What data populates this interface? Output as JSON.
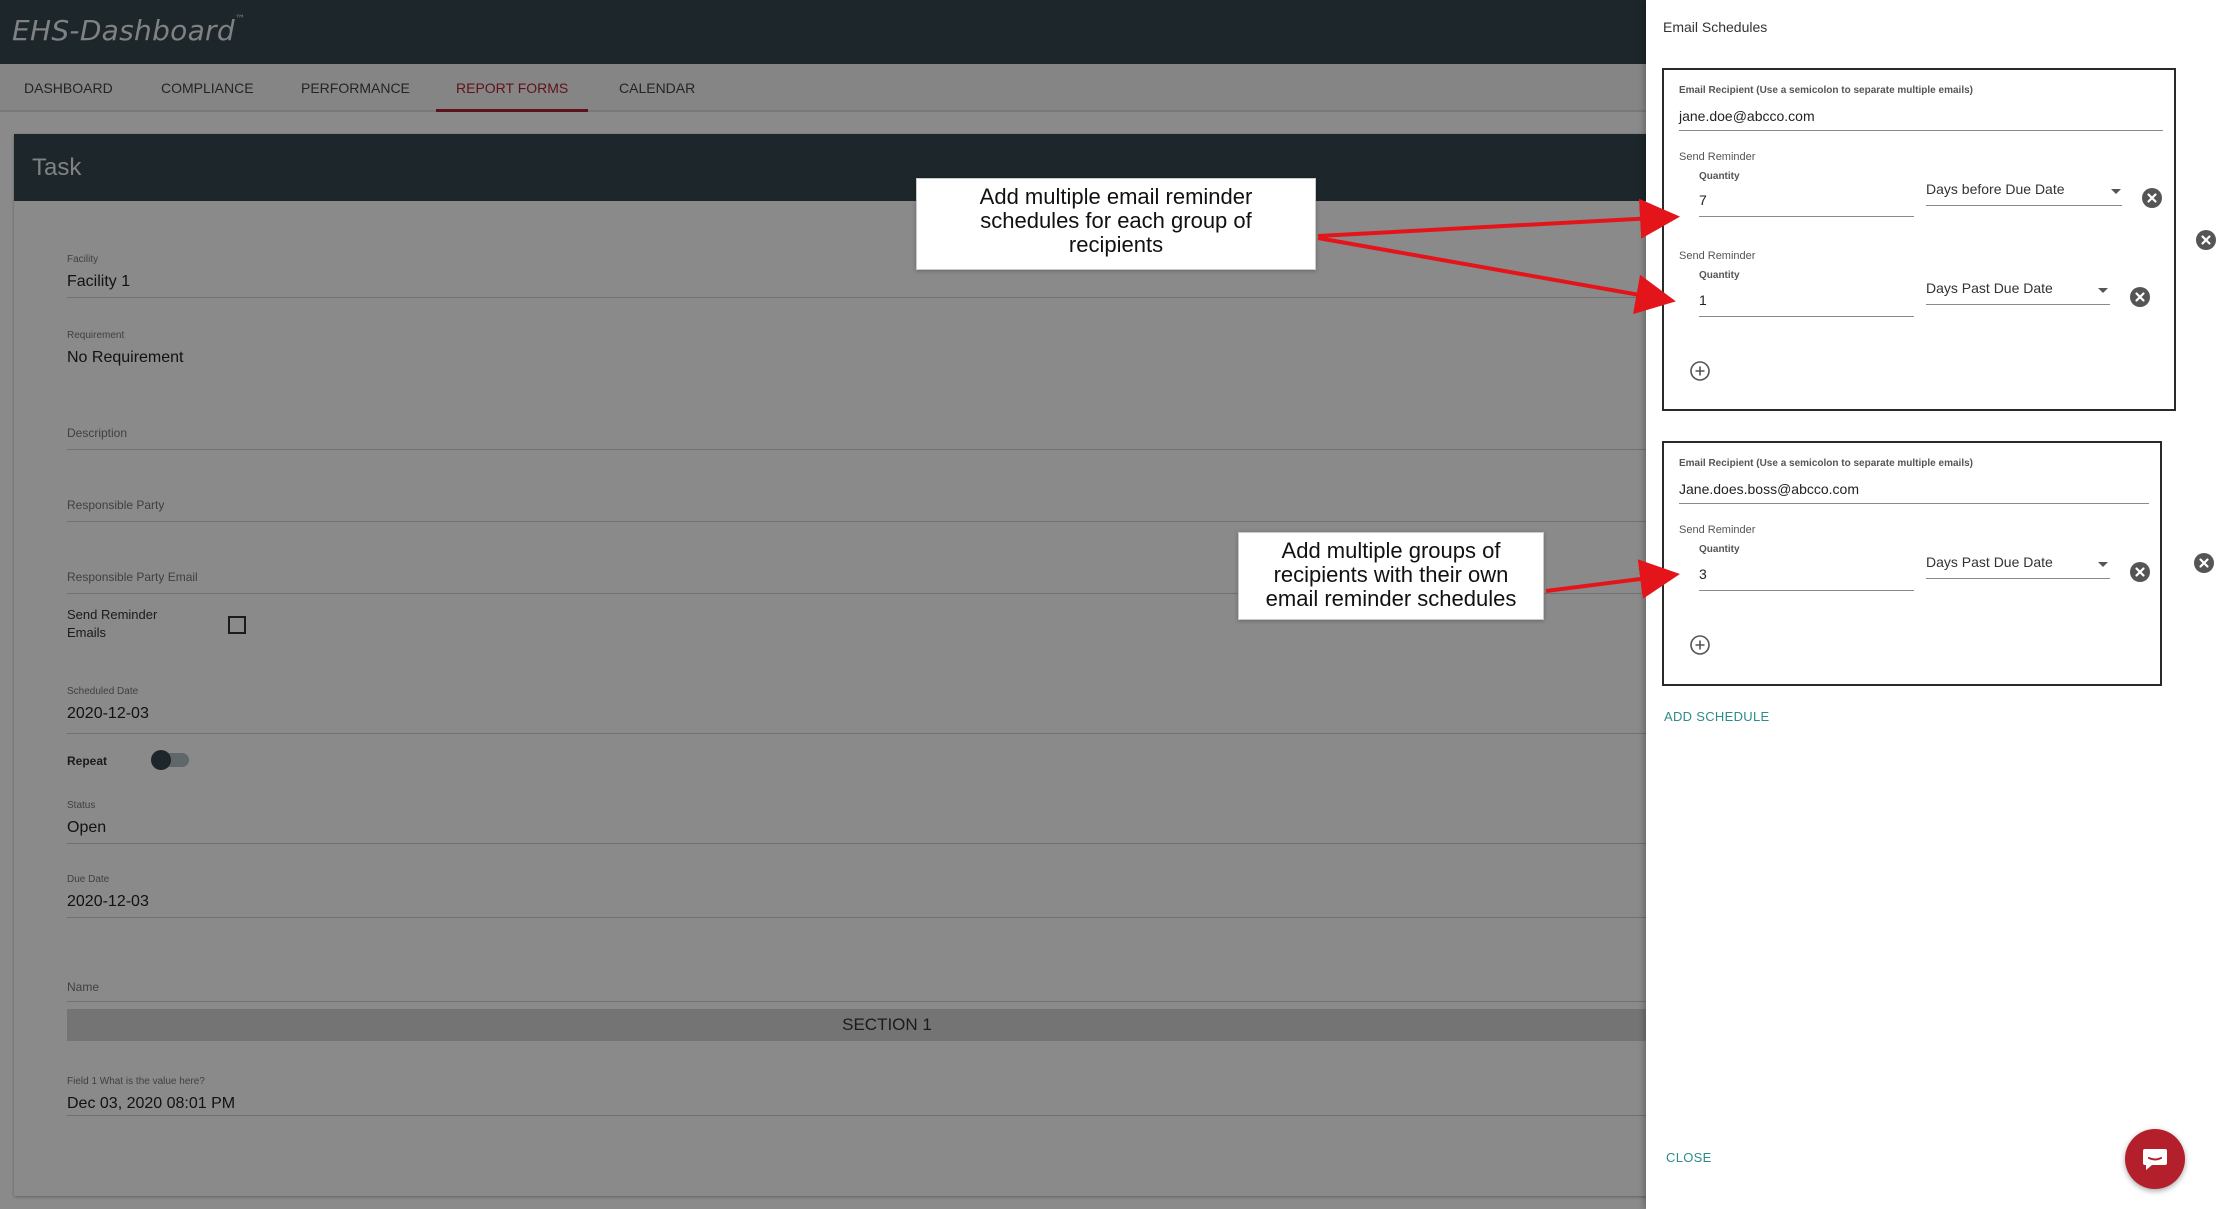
{
  "app": {
    "logo": "EHS-Dashboard",
    "logo_tm": "™",
    "nav": [
      "DASHBOARD",
      "COMPLIANCE",
      "PERFORMANCE",
      "REPORT FORMS",
      "CALENDAR"
    ],
    "active_nav": "REPORT FORMS"
  },
  "task": {
    "title": "Task",
    "fields": [
      {
        "label": "Facility",
        "value": "Facility 1"
      },
      {
        "label": "Requirement",
        "value": "No Requirement"
      },
      {
        "label": "Description",
        "value": ""
      },
      {
        "label": "Responsible Party",
        "value": ""
      },
      {
        "label": "Responsible Party Email",
        "value": ""
      },
      {
        "label": "Scheduled Date",
        "value": "2020-12-03"
      },
      {
        "label": "Status",
        "value": "Open"
      },
      {
        "label": "Due Date",
        "value": "2020-12-03"
      },
      {
        "label": "Name",
        "value": ""
      },
      {
        "label": "Field 1 What is the value here?",
        "value": "Dec 03, 2020 08:01 PM"
      }
    ],
    "send_reminder_label_1": "Send Reminder",
    "send_reminder_label_2": "Emails",
    "repeat_label": "Repeat",
    "section_label": "SECTION 1"
  },
  "drawer": {
    "title": "Email Schedules",
    "email_label": "Email Recipient (Use a semicolon to separate multiple emails)",
    "send_reminder": "Send Reminder",
    "quantity": "Quantity",
    "groups": [
      {
        "email": "jane.doe@abcco.com",
        "reminders": [
          {
            "quantity": "7",
            "when": "Days before Due Date"
          },
          {
            "quantity": "1",
            "when": "Days Past Due Date"
          }
        ]
      },
      {
        "email": "Jane.does.boss@abcco.com",
        "reminders": [
          {
            "quantity": "3",
            "when": "Days Past Due Date"
          }
        ]
      }
    ],
    "add_schedule": "ADD SCHEDULE",
    "close": "CLOSE"
  },
  "callouts": {
    "top": [
      "Add multiple email reminder",
      "schedules for each group of",
      "recipients"
    ],
    "bottom": [
      "Add multiple groups of",
      "recipients with their own",
      "email reminder schedules"
    ]
  },
  "colors": {
    "header": "#37474f",
    "accent": "#b22234",
    "link": "#2e8b8b",
    "arrow": "#e3151b"
  }
}
